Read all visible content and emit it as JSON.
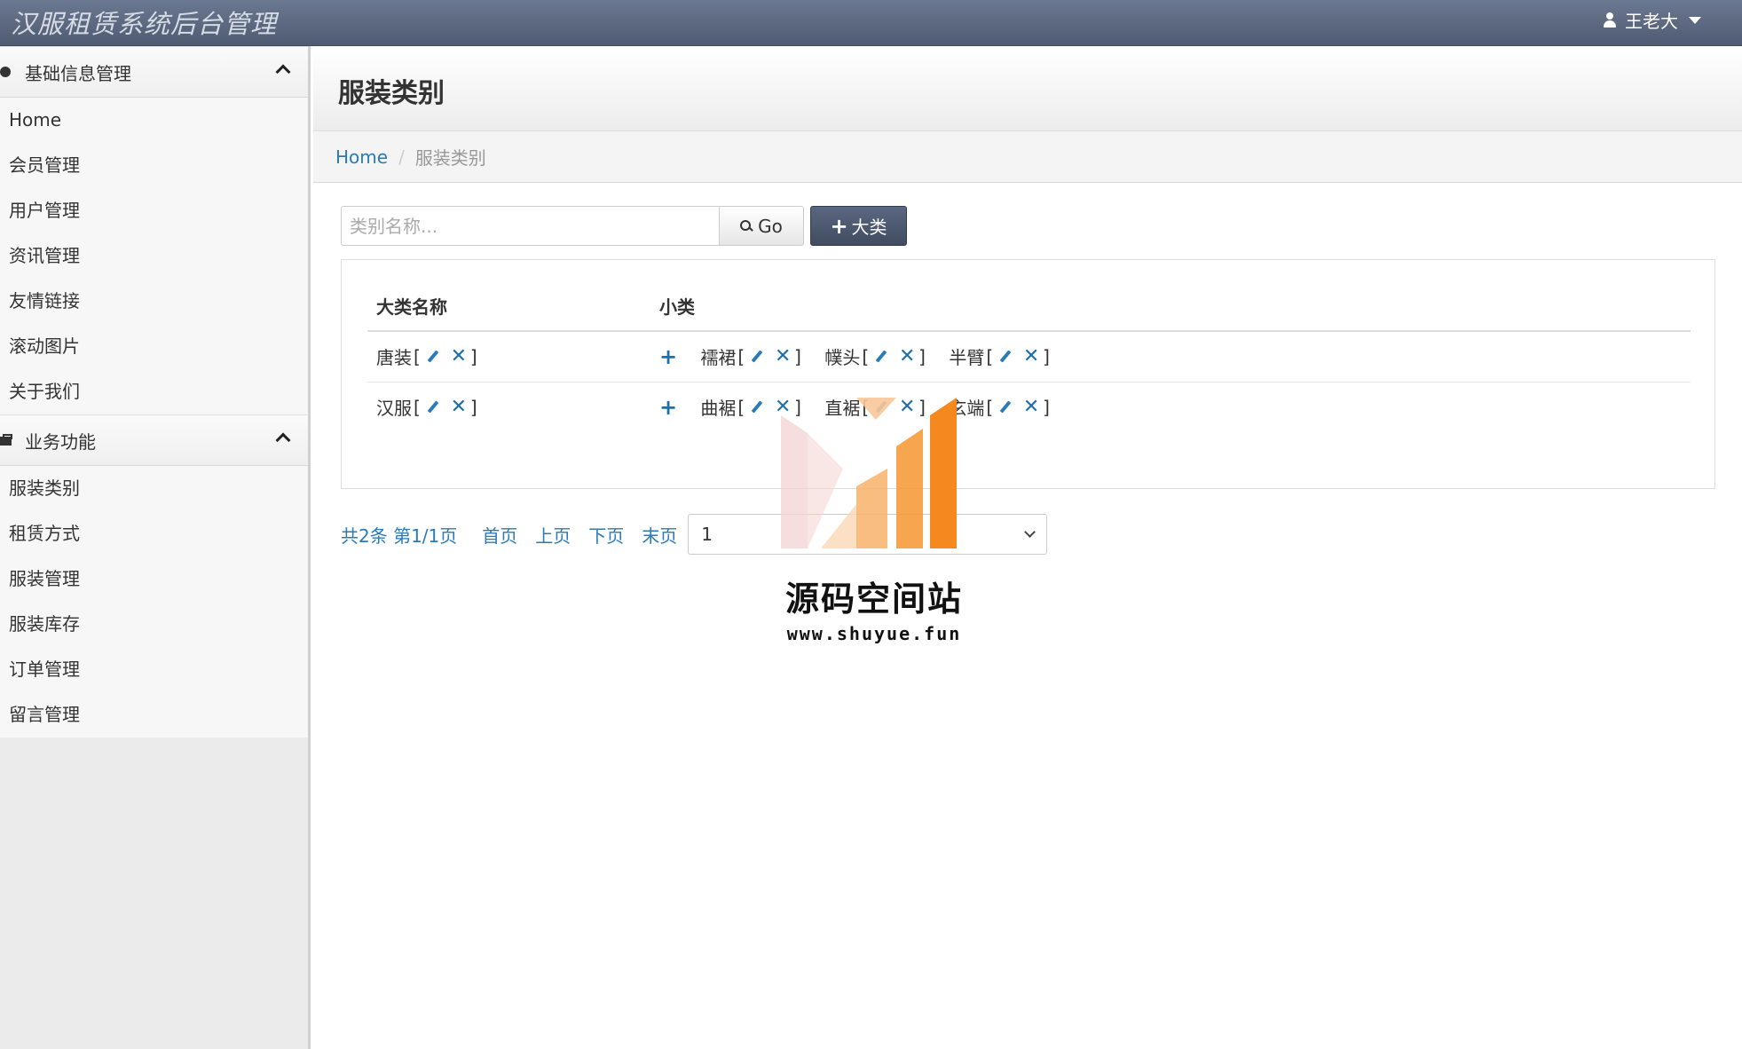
{
  "app": {
    "title": "汉服租赁系统后台管理"
  },
  "user": {
    "name": "王老大"
  },
  "sidebar": {
    "groups": [
      {
        "label": "基础信息管理",
        "items": [
          "Home",
          "会员管理",
          "用户管理",
          "资讯管理",
          "友情链接",
          "滚动图片",
          "关于我们"
        ]
      },
      {
        "label": "业务功能",
        "items": [
          "服装类别",
          "租赁方式",
          "服装管理",
          "服装库存",
          "订单管理",
          "留言管理"
        ]
      }
    ]
  },
  "page": {
    "title": "服装类别",
    "breadcrumb": {
      "home": "Home",
      "current": "服装类别"
    }
  },
  "toolbar": {
    "search_placeholder": "类别名称...",
    "go_label": "Go",
    "add_major_label": "大类"
  },
  "table": {
    "headers": [
      "大类名称",
      "小类"
    ],
    "rows": [
      {
        "major": "唐装",
        "minors": [
          "襦裙",
          "幞头",
          "半臂"
        ]
      },
      {
        "major": "汉服",
        "minors": [
          "曲裾",
          "直裾",
          "玄端"
        ]
      }
    ],
    "bracket_open": "[",
    "bracket_close": "]",
    "delete_glyph": "✕",
    "add_glyph": "+"
  },
  "pager": {
    "summary": "共2条 第1/1页",
    "first": "首页",
    "prev": "上页",
    "next": "下页",
    "last": "末页",
    "selected_page": "1"
  },
  "watermark": {
    "text": "源码空间站",
    "url": "www.shuyue.fun"
  },
  "icons": {
    "sidebar_group_1": "dashboard-icon",
    "sidebar_group_2": "briefcase-icon",
    "edit": "pencil-icon",
    "delete": "x-icon",
    "add": "plus-icon",
    "search": "search-icon",
    "user": "user-icon"
  },
  "colors": {
    "navbar": "#5a6780",
    "link": "#2a7bb6",
    "primary_btn": "#4a5568",
    "watermark_orange": "#f5891f"
  }
}
